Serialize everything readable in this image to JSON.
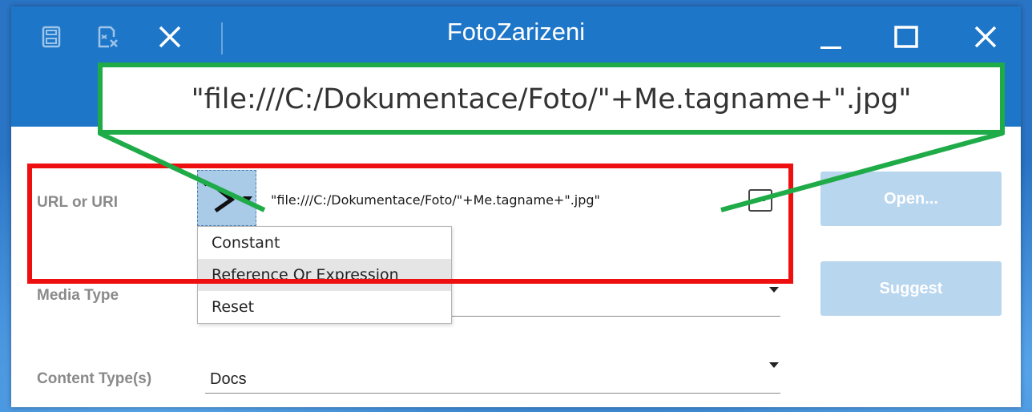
{
  "window": {
    "title": "FotoZarizeni"
  },
  "toolbar": {
    "icons": [
      "save-icon",
      "discard-icon",
      "close-icon"
    ]
  },
  "window_controls": [
    "minimize-icon",
    "maximize-icon",
    "close-icon"
  ],
  "form": {
    "url_label": "URL or URI",
    "url_value": "\"file:///C:/Dokumentace/Foto/\"+Me.tagname+\".jpg\"",
    "ellipsis_label": "...",
    "media_type_label": "Media Type",
    "media_type_value": "",
    "content_type_label": "Content Type(s)",
    "content_type_value": "Docs"
  },
  "buttons": {
    "open_label": "Open...",
    "suggest_label": "Suggest"
  },
  "mode_menu": {
    "items": [
      "Constant",
      "Reference Or Expression",
      "Reset"
    ],
    "highlighted_index": 1
  },
  "callout": {
    "zoomed_text": "\"file:///C:/Dokumentace/Foto/\"+Me.tagname+\".jpg\""
  },
  "colors": {
    "titlebar": "#1d76c8",
    "highlight_box": "#ee1010",
    "callout_box": "#1fab48",
    "disabled_button": "#b9d6ef"
  }
}
